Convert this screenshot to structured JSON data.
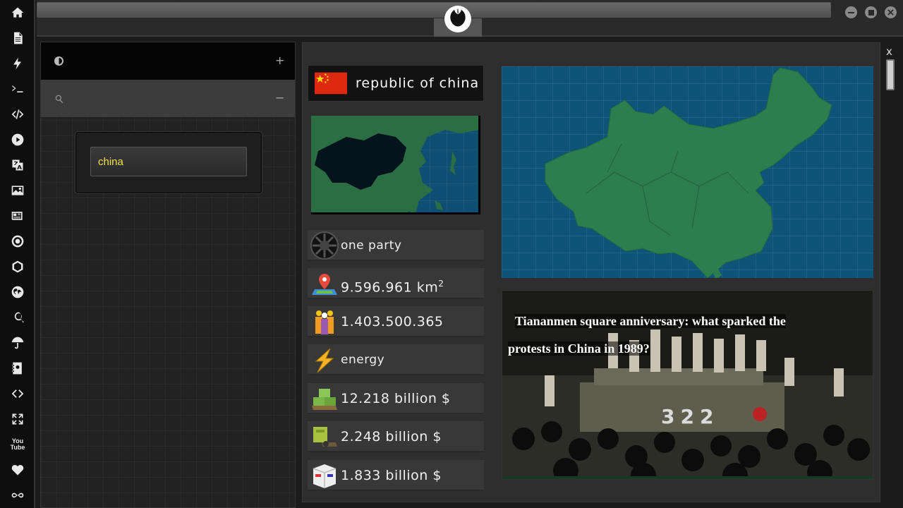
{
  "sidebar": {
    "icons": [
      "home-icon",
      "document-icon",
      "bolt-icon",
      "terminal-icon",
      "code-icon",
      "play-icon",
      "translate-icon",
      "image-icon",
      "news-icon",
      "empire-icon",
      "rebel-icon",
      "globe-icon",
      "search-icon",
      "umbrella-icon",
      "contacts-icon",
      "transfer-icon",
      "fullscreen-icon",
      "youtube-icon",
      "heart-icon",
      "infinity-icon"
    ],
    "youtube_text": "You Tube"
  },
  "left_panel": {
    "header_plus": "+",
    "header_minus": "−",
    "search": {
      "value": "china",
      "placeholder": ""
    }
  },
  "country": {
    "name": "republic of china",
    "government": "one party",
    "area": "9.596.961 km",
    "area_unit_sup": "2",
    "population": "1.403.500.365",
    "main_sector": "energy",
    "value_1": "12.218 billion $",
    "value_2": "2.248 billion $",
    "value_3": "1.833 billion $"
  },
  "news": {
    "headline": "Tiananmen square anniversary: what sparked the protests in China in 1989?",
    "image_number": "322"
  },
  "window": {
    "close_label": "x"
  },
  "colors": {
    "accent_text": "#f1e24a",
    "map_ocean": "#0e5378",
    "map_land": "#2e7d4f"
  }
}
